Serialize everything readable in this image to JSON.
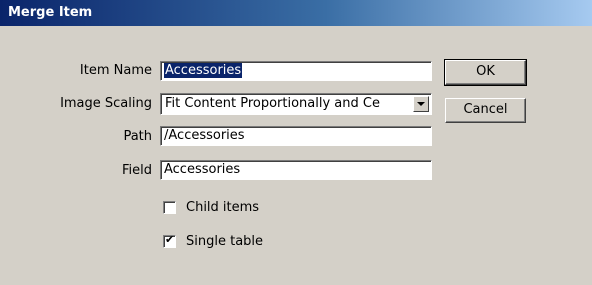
{
  "window": {
    "title": "Merge Item"
  },
  "form": {
    "item_name": {
      "label": "Item Name",
      "value": "Accessories"
    },
    "image_scaling": {
      "label": "Image Scaling",
      "value": "Fit Content Proportionally and Ce"
    },
    "path": {
      "label": "Path",
      "value": "/Accessories"
    },
    "field": {
      "label": "Field",
      "value": "Accessories"
    }
  },
  "options": {
    "child_items": {
      "label": "Child items",
      "checked": false
    },
    "single_table": {
      "label": "Single table",
      "checked": true,
      "mark": "✔"
    }
  },
  "buttons": {
    "ok": "OK",
    "cancel": "Cancel"
  },
  "icons": {
    "combo_arrow": "chevron-down-icon",
    "check_mark": "checkmark-icon"
  }
}
